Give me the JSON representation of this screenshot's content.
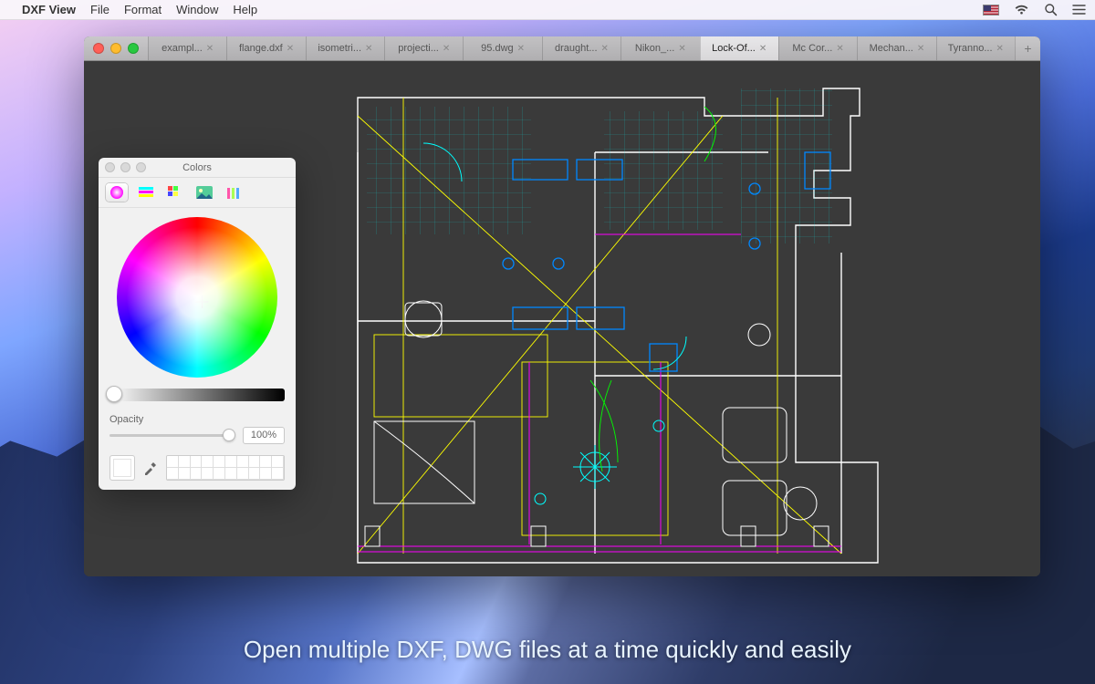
{
  "menubar": {
    "appname": "DXF View",
    "items": [
      "File",
      "Format",
      "Window",
      "Help"
    ]
  },
  "tabs": [
    {
      "label": "exampl..."
    },
    {
      "label": "flange.dxf"
    },
    {
      "label": "isometri..."
    },
    {
      "label": "projecti..."
    },
    {
      "label": "95.dwg"
    },
    {
      "label": "draught..."
    },
    {
      "label": "Nikon_..."
    },
    {
      "label": "Lock-Of...",
      "active": true
    },
    {
      "label": "Mc Cor..."
    },
    {
      "label": "Mechan..."
    },
    {
      "label": "Tyranno..."
    }
  ],
  "colors_panel": {
    "title": "Colors",
    "opacity_label": "Opacity",
    "opacity_value": "100%"
  },
  "caption": "Open multiple DXF, DWG files at a time quickly and easily"
}
